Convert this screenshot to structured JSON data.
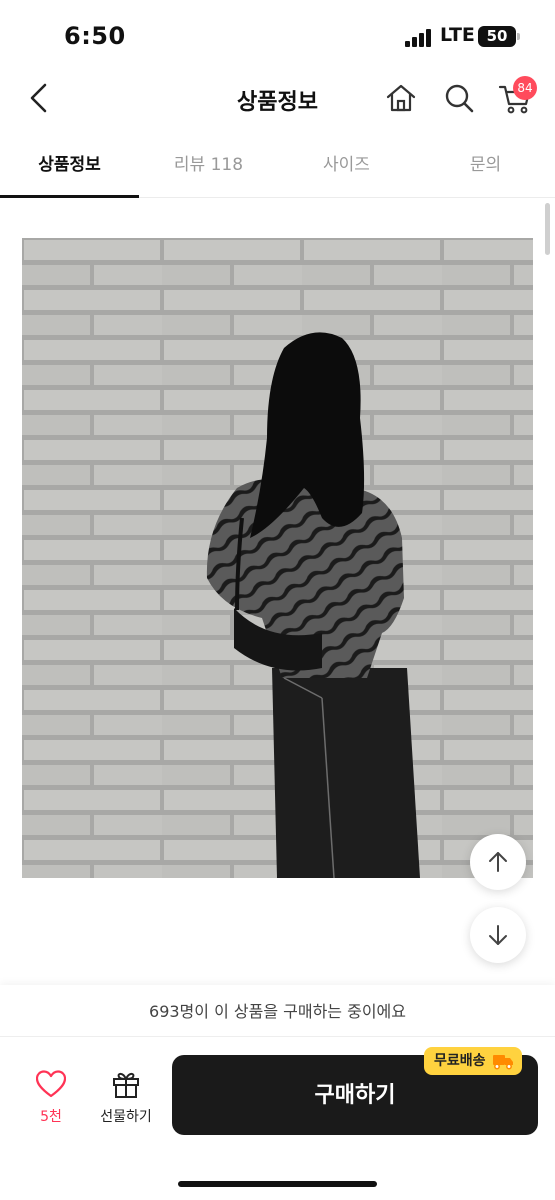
{
  "status_bar": {
    "time": "6:50",
    "network": "LTE",
    "battery": "50"
  },
  "header": {
    "title": "상품정보",
    "cart_badge": "84",
    "icons": [
      "back-chevron-icon",
      "home-icon",
      "search-icon",
      "cart-icon"
    ]
  },
  "tabs": [
    {
      "label": "상품정보",
      "active": true
    },
    {
      "label": "리뷰 118",
      "active": false
    },
    {
      "label": "사이즈",
      "active": false
    },
    {
      "label": "문의",
      "active": false
    }
  ],
  "product": {
    "image": "product-photo-model-zebra-jacket"
  },
  "bottom": {
    "notice": "693명이 이 상품을 구매하는 중이에요",
    "like_count": "5천",
    "gift_label": "선물하기",
    "buy_label": "구매하기",
    "free_shipping_label": "무료배송"
  },
  "colors": {
    "accent_red": "#ff4b5c",
    "buy_button": "#1a1a1a",
    "badge_yellow": "#ffd23f",
    "heart_pink": "#ff3355"
  }
}
